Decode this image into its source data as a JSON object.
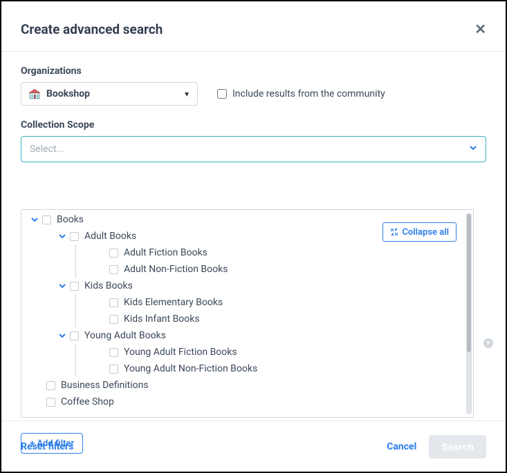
{
  "header": {
    "title": "Create advanced search",
    "close_icon": "close-icon"
  },
  "organizations": {
    "label": "Organizations",
    "selected": "Bookshop",
    "include_community_label": "Include results from the community"
  },
  "collection_scope": {
    "label": "Collection Scope",
    "placeholder": "Select...",
    "collapse_all": "Collapse all"
  },
  "tree": {
    "n0": "Books",
    "n1": "Adult Books",
    "n1a": "Adult Fiction Books",
    "n1b": "Adult Non-Fiction Books",
    "n2": "Kids Books",
    "n2a": "Kids Elementary Books",
    "n2b": "Kids Infant Books",
    "n3": "Young Adult Books",
    "n3a": "Young Adult Fiction Books",
    "n3b": "Young Adult Non-Fiction Books",
    "n4": "Business Definitions",
    "n5": "Coffee Shop"
  },
  "add_filter": "+ Add filter",
  "footer": {
    "reset": "Reset filters",
    "cancel": "Cancel",
    "search": "Search"
  }
}
